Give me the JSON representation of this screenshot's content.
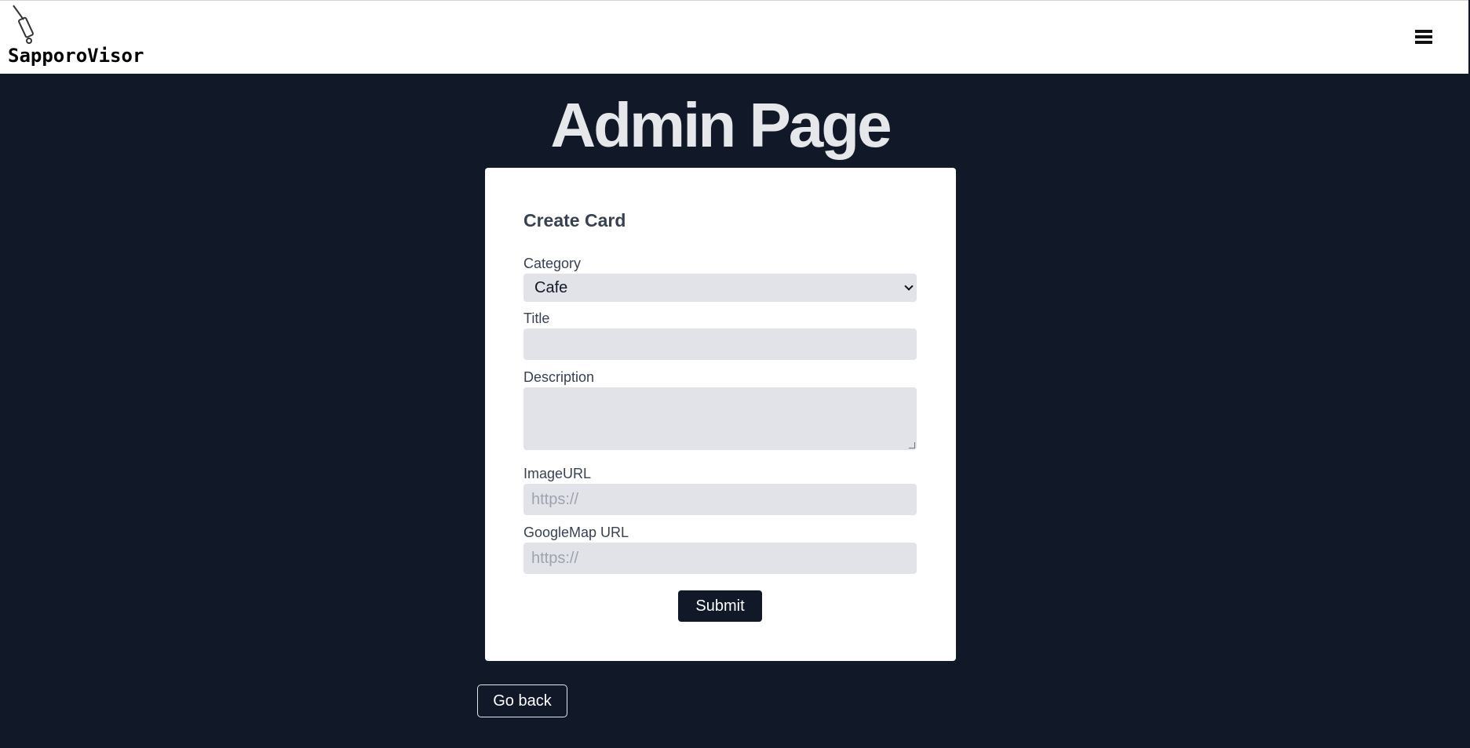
{
  "header": {
    "brand": "SapporoVisor",
    "logo_icon": "suitcase-cart-icon",
    "menu_icon": "hamburger-menu-icon"
  },
  "page": {
    "title": "Admin Page"
  },
  "form": {
    "title": "Create Card",
    "category_label": "Category",
    "category_value": "Cafe",
    "title_label": "Title",
    "title_value": "",
    "description_label": "Description",
    "description_value": "",
    "image_url_label": "ImageURL",
    "image_url_placeholder": "https://",
    "googlemap_url_label": "GoogleMap URL",
    "googlemap_url_placeholder": "https://",
    "submit_label": "Submit"
  },
  "footer": {
    "go_back_label": "Go back"
  },
  "colors": {
    "background": "#111827",
    "card": "#ffffff",
    "field": "#e2e3e8",
    "button": "#111827"
  }
}
